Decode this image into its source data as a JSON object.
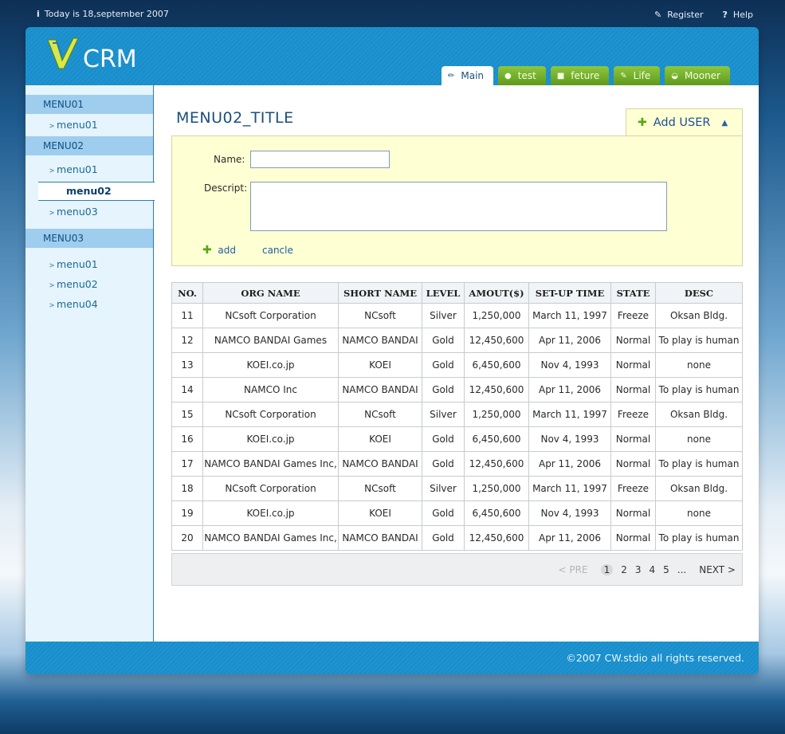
{
  "topbar": {
    "date_text": "Today is 18,september 2007",
    "register_label": "Register",
    "help_label": "Help"
  },
  "app": {
    "logo_text": "CRM"
  },
  "tabs": [
    {
      "label": "Main",
      "active": true
    },
    {
      "label": "test"
    },
    {
      "label": "feture"
    },
    {
      "label": "Life"
    },
    {
      "label": "Mooner"
    }
  ],
  "sidebar": {
    "sections": [
      {
        "title": "MENU01",
        "items": [
          "menu01"
        ]
      },
      {
        "title": "MENU02",
        "items": [
          "menu01",
          "menu02",
          "menu03"
        ],
        "active_item": "menu02"
      },
      {
        "title": "MENU03",
        "items": [
          "menu01",
          "menu02",
          "menu04"
        ]
      }
    ]
  },
  "main": {
    "title": "MENU02_TITLE",
    "add_user_label": "Add USER",
    "form": {
      "name_label": "Name:",
      "name_value": "",
      "descript_label": "Descript:",
      "descript_value": "",
      "add_label": "add",
      "cancel_label": "cancle"
    }
  },
  "table": {
    "headers": [
      "NO.",
      "ORG NAME",
      "SHORT NAME",
      "LEVEL",
      "AMOUT($)",
      "SET-UP TIME",
      "STATE",
      "DESC"
    ],
    "rows": [
      [
        "11",
        "NCsoft Corporation",
        "NCsoft",
        "Silver",
        "1,250,000",
        "March 11, 1997",
        "Freeze",
        "Oksan Bldg."
      ],
      [
        "12",
        "NAMCO BANDAI Games",
        "NAMCO BANDAI",
        "Gold",
        "12,450,600",
        "Apr 11, 2006",
        "Normal",
        "To play is human"
      ],
      [
        "13",
        "KOEI.co.jp",
        "KOEI",
        "Gold",
        "6,450,600",
        "Nov 4, 1993",
        "Normal",
        "none"
      ],
      [
        "14",
        "NAMCO Inc",
        "NAMCO BANDAI",
        "Gold",
        "12,450,600",
        "Apr 11, 2006",
        "Normal",
        "To play is human"
      ],
      [
        "15",
        "NCsoft Corporation",
        "NCsoft",
        "Silver",
        "1,250,000",
        "March 11, 1997",
        "Freeze",
        "Oksan Bldg."
      ],
      [
        "16",
        "KOEI.co.jp",
        "KOEI",
        "Gold",
        "6,450,600",
        "Nov 4, 1993",
        "Normal",
        "none"
      ],
      [
        "17",
        "NAMCO BANDAI Games Inc,",
        "NAMCO BANDAI",
        "Gold",
        "12,450,600",
        "Apr 11, 2006",
        "Normal",
        "To play is human"
      ],
      [
        "18",
        "NCsoft Corporation",
        "NCsoft",
        "Silver",
        "1,250,000",
        "March 11, 1997",
        "Freeze",
        "Oksan Bldg."
      ],
      [
        "19",
        "KOEI.co.jp",
        "KOEI",
        "Gold",
        "6,450,600",
        "Nov 4, 1993",
        "Normal",
        "none"
      ],
      [
        "20",
        "NAMCO BANDAI Games Inc,",
        "NAMCO BANDAI",
        "Gold",
        "12,450,600",
        "Apr 11, 2006",
        "Normal",
        "To play is human"
      ]
    ]
  },
  "pager": {
    "prev_label": "< PRE",
    "pages": [
      "1",
      "2",
      "3",
      "4",
      "5"
    ],
    "current_page": "1",
    "ellipsis": "...",
    "next_label": "NEXT >"
  },
  "footer": {
    "copyright": "©2007 CW.stdio all rights reserved."
  },
  "icons": {
    "info": "info-icon",
    "register": "register-icon",
    "help": "help-icon",
    "add": "add-plus-icon"
  },
  "colors": {
    "header_blue": "#1e95d2",
    "tab_green": "#7cb82f",
    "sidebar_head": "#9ecdee",
    "form_yellow": "#ffffd4"
  }
}
